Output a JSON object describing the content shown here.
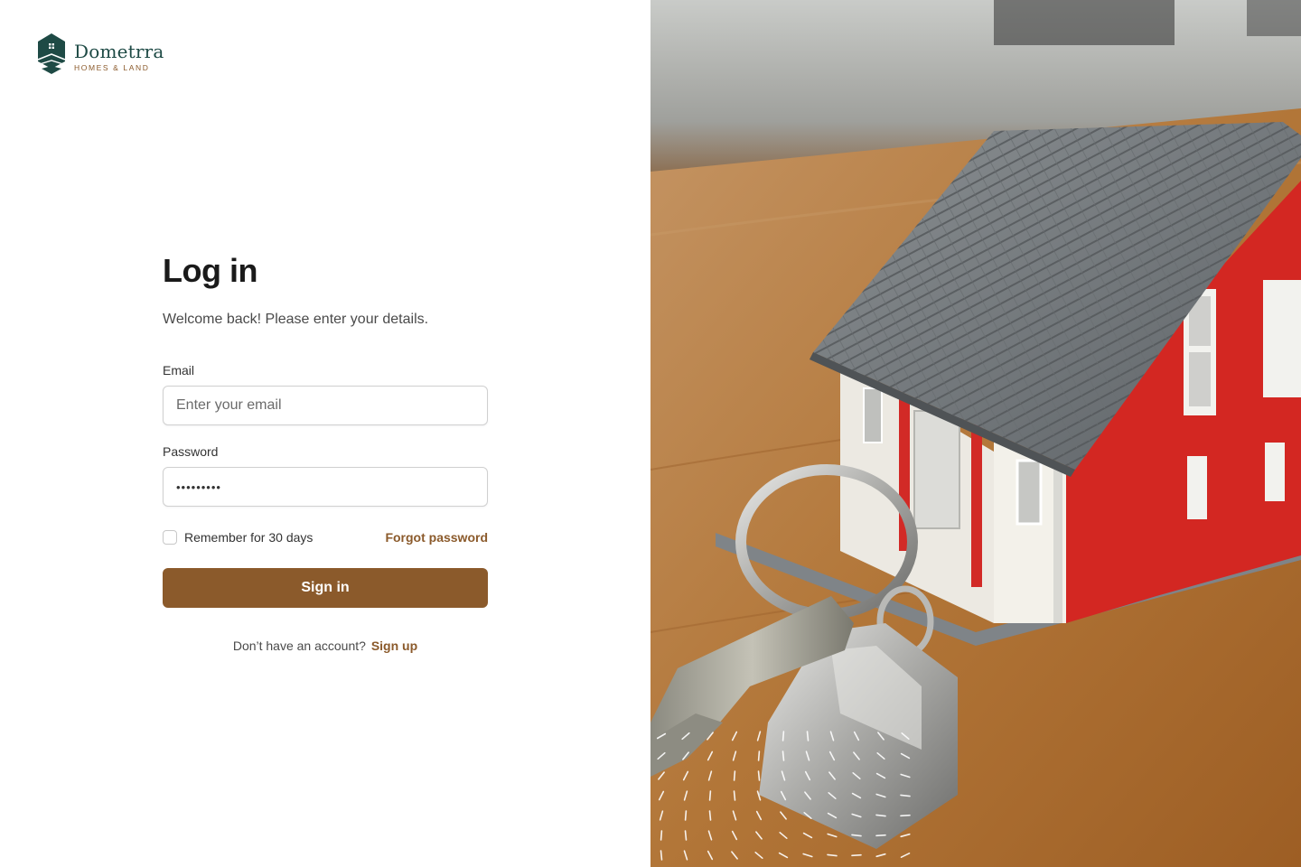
{
  "brand": {
    "name": "Dometrra",
    "tagline": "HOMES & LAND",
    "logo_icon": "house-shield-icon",
    "colors": {
      "primary": "#1e4a45",
      "accent": "#8b5a2b"
    }
  },
  "login": {
    "title": "Log in",
    "subtitle": "Welcome back! Please enter your details.",
    "email": {
      "label": "Email",
      "placeholder": "Enter your email",
      "value": ""
    },
    "password": {
      "label": "Password",
      "value": "•••••••••"
    },
    "remember_label": "Remember for 30 days",
    "remember_checked": false,
    "forgot_label": "Forgot password",
    "submit_label": "Sign in",
    "signup_prompt": "Don’t have an account?",
    "signup_link": "Sign up"
  },
  "hero": {
    "image": "model-house-with-keys-photo",
    "pattern": "dash-pattern-decoration"
  }
}
